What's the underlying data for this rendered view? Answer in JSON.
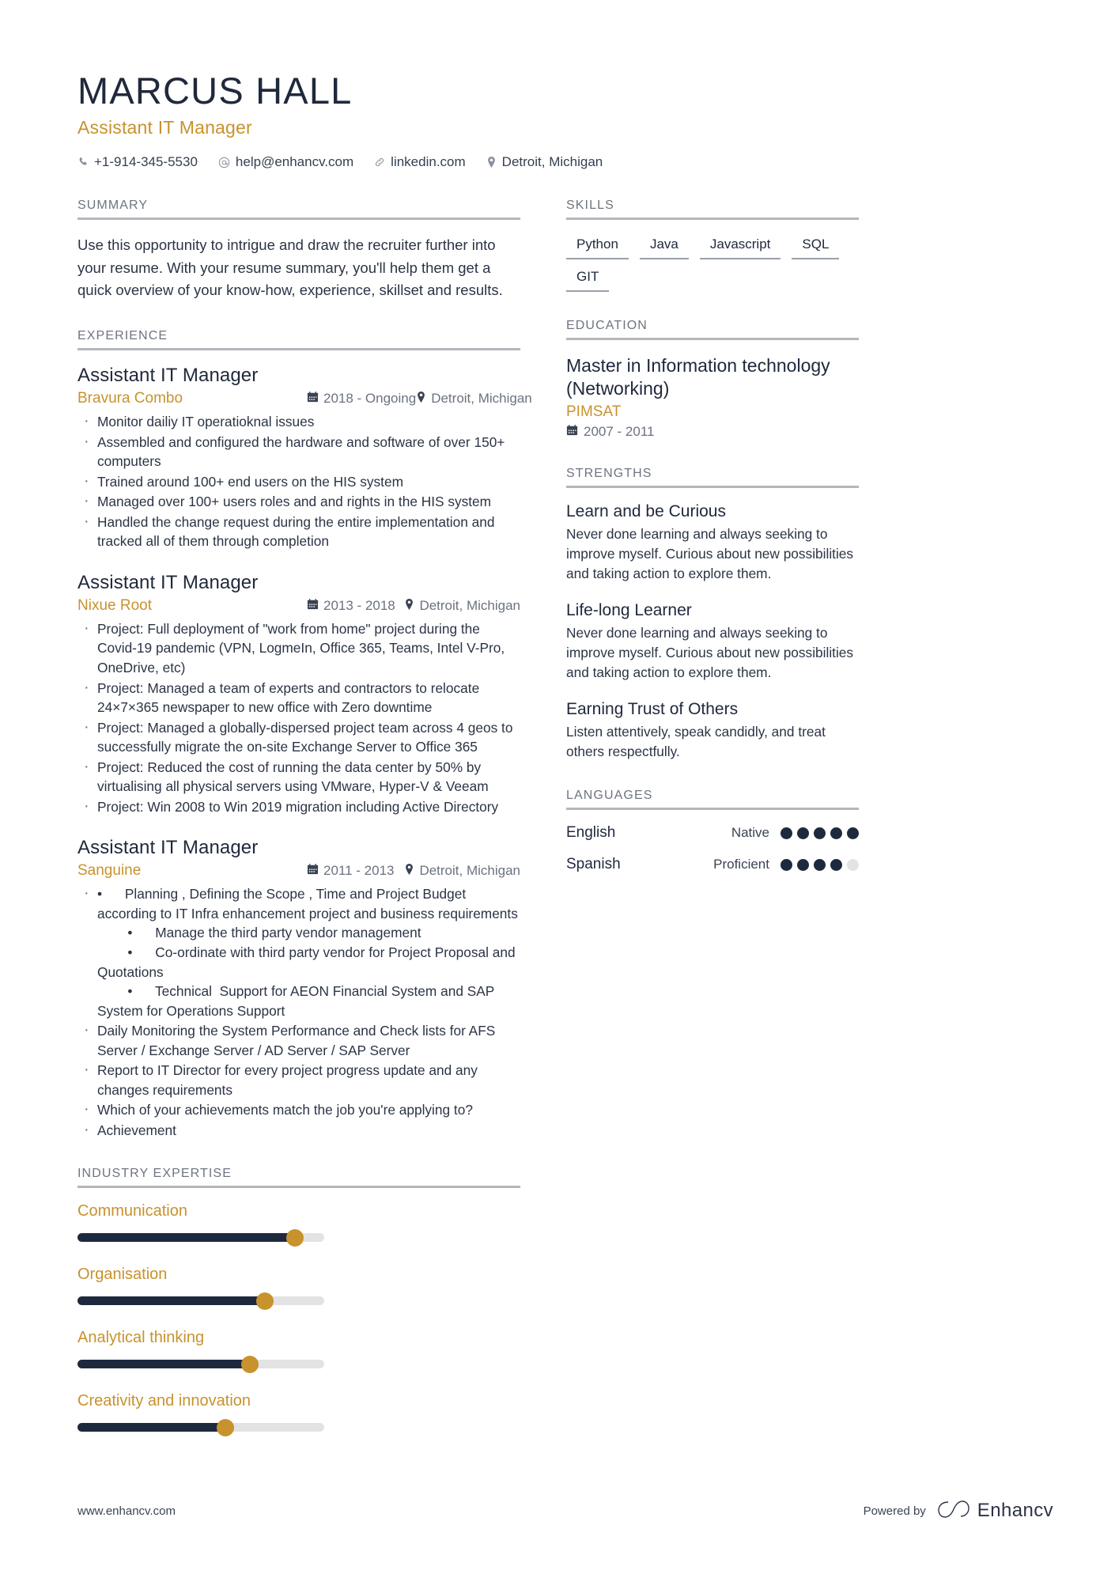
{
  "header": {
    "name": "MARCUS HALL",
    "job_title": "Assistant IT Manager",
    "contacts": [
      {
        "icon": "phone-icon",
        "text": "+1-914-345-5530"
      },
      {
        "icon": "email-icon",
        "text": "help@enhancv.com"
      },
      {
        "icon": "link-icon",
        "text": "linkedin.com"
      },
      {
        "icon": "location-pin-icon",
        "text": "Detroit, Michigan"
      }
    ]
  },
  "summary": {
    "heading": "SUMMARY",
    "text": "Use this opportunity to intrigue and draw the recruiter further into your resume. With your resume summary, you'll help them get a quick overview of your know-how, experience, skillset and results."
  },
  "experience": {
    "heading": "EXPERIENCE",
    "jobs": [
      {
        "role": "Assistant IT Manager",
        "company": "Bravura Combo",
        "date": "2018 - Ongoing",
        "location": "Detroit, Michigan",
        "bullets": [
          "Monitor dailiy IT operatioknal issues",
          "Assembled and configured the hardware and software of over 150+ computers",
          "Trained around 100+ end users on the HIS system",
          "Managed over 100+ users roles and and rights in the HIS system",
          "Handled the change request during the entire implementation and tracked all of them through completion"
        ]
      },
      {
        "role": "Assistant IT Manager",
        "company": "Nixue Root",
        "date": "2013 - 2018",
        "location": "Detroit, Michigan",
        "bullets": [
          "Project: Full deployment of \"work from home\" project during the Covid-19 pandemic (VPN, LogmeIn, Office 365, Teams, Intel V-Pro, OneDrive, etc)",
          "Project: Managed a team of experts and contractors to relocate 24×7×365 newspaper to new office with Zero downtime",
          "Project: Managed a globally-dispersed project team across 4 geos to successfully migrate the on-site Exchange Server to Office 365",
          "Project: Reduced the cost of running the data center by 50% by virtualising all physical servers using VMware, Hyper-V & Veeam",
          "Project: Win 2008 to Win 2019 migration including Active Directory"
        ]
      },
      {
        "role": "Assistant IT Manager",
        "company": "Sanguine",
        "date": "2011 - 2013",
        "location": "Detroit, Michigan",
        "bullets": [
          "•      Planning , Defining the Scope , Time and Project Budget according to IT Infra enhancement project and business requirements\n        •      Manage the third party vendor management\n        •      Co-ordinate with third party vendor for Project Proposal and Quotations\n        •      Technical  Support for AEON Financial System and SAP System for Operations Support",
          "Daily Monitoring the System Performance and Check lists for  AFS Server / Exchange Server / AD Server / SAP Server",
          "Report to IT Director for every project progress update and any changes requirements",
          "Which of your achievements match the job you're applying to?",
          "Achievement"
        ]
      }
    ]
  },
  "industry_expertise": {
    "heading": "INDUSTRY EXPERTISE",
    "items": [
      {
        "label": "Communication",
        "value": 88
      },
      {
        "label": "Organisation",
        "value": 76
      },
      {
        "label": "Analytical thinking",
        "value": 70
      },
      {
        "label": "Creativity and innovation",
        "value": 60
      }
    ]
  },
  "skills": {
    "heading": "SKILLS",
    "items": [
      "Python",
      "Java",
      "Javascript",
      "SQL",
      "GIT"
    ]
  },
  "education": {
    "heading": "EDUCATION",
    "entries": [
      {
        "degree": "Master in Information technology (Networking)",
        "school": "PIMSAT",
        "date": "2007 - 2011"
      }
    ]
  },
  "strengths": {
    "heading": "STRENGTHS",
    "items": [
      {
        "title": "Learn and be Curious",
        "desc": "Never done learning and always seeking to improve myself. Curious about new possibilities and taking action to explore them."
      },
      {
        "title": "Life-long Learner",
        "desc": "Never done learning and always seeking to improve myself. Curious about new possibilities and taking action to explore them."
      },
      {
        "title": "Earning Trust of Others",
        "desc": "Listen attentively, speak candidly, and treat others respectfully."
      }
    ]
  },
  "languages": {
    "heading": "LANGUAGES",
    "items": [
      {
        "name": "English",
        "level": "Native",
        "filled": 5,
        "total": 5
      },
      {
        "name": "Spanish",
        "level": "Proficient",
        "filled": 4,
        "total": 5
      }
    ]
  },
  "footer": {
    "website": "www.enhancv.com",
    "powered_by": "Powered by",
    "brand": "Enhancv"
  },
  "colors": {
    "accent": "#c8922d",
    "dark": "#20293c",
    "muted": "#6b7280",
    "rule": "#b3b6bb"
  }
}
